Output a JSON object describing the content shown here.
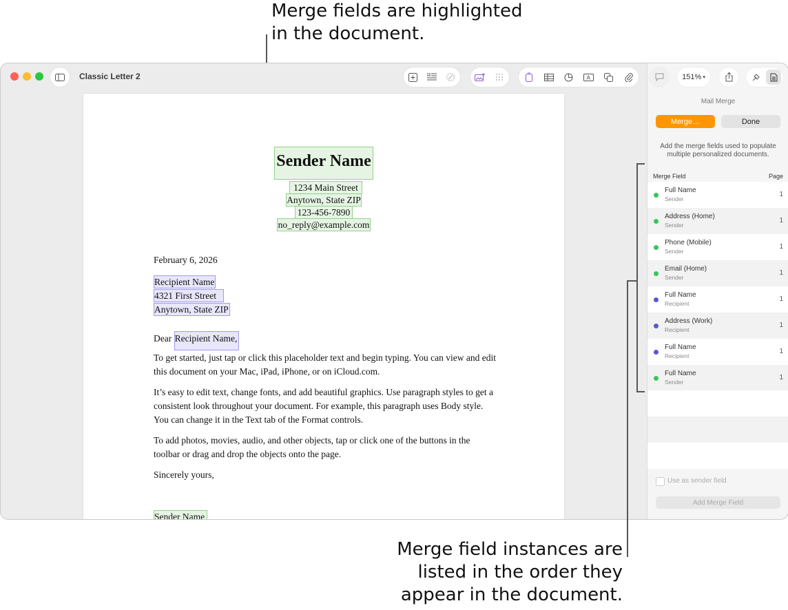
{
  "callouts": {
    "top": [
      "Merge fields are highlighted",
      "in the document."
    ],
    "bottom": [
      "Merge field instances are",
      "listed in the order they",
      "appear in the document."
    ]
  },
  "window": {
    "title": "Classic Letter 2",
    "zoom_label": "151%",
    "toolbar_icons": [
      "sidebar-icon",
      "add-page-icon",
      "list-icon",
      "magic-icon",
      "media-icon",
      "grid-icon",
      "text-box-icon",
      "table-icon",
      "chart-icon",
      "text-icon",
      "shape-icon",
      "attachment-icon",
      "comment-icon",
      "share-icon",
      "format-icon",
      "document-icon"
    ]
  },
  "document": {
    "sender_name": "Sender Name",
    "sender_address": [
      "1234 Main Street",
      "Anytown, State ZIP",
      "123-456-7890",
      "no_reply@example.com"
    ],
    "date": "February 6, 2026",
    "recipient_lines": [
      "Recipient Name",
      "4321 First Street",
      "Anytown, State ZIP"
    ],
    "salutation_prefix": "Dear ",
    "salutation_field": "Recipient Name,",
    "paragraphs": [
      "To get started, just tap or click this placeholder text and begin typing. You can view and edit this document on your Mac, iPad, iPhone, or on iCloud.com.",
      "It’s easy to edit text, change fonts, and add beautiful graphics. Use paragraph styles to get a consistent look throughout your document. For example, this paragraph uses Body style. You can change it in the Text tab of the Format controls.",
      "To add photos, movies, audio, and other objects, tap or click one of the buttons in the toolbar or drag and drop the objects onto the page."
    ],
    "closing": "Sincerely yours,",
    "signature_field": "Sender Name"
  },
  "sidebar": {
    "panel_title": "Mail Merge",
    "merge_button": "Merge…",
    "done_button": "Done",
    "description": "Add the merge fields used to populate multiple personalized documents.",
    "col_field": "Merge Field",
    "col_page": "Page",
    "fields": [
      {
        "name": "Full Name",
        "role": "Sender",
        "page": "1",
        "color": "#34c759"
      },
      {
        "name": "Address (Home)",
        "role": "Sender",
        "page": "1",
        "color": "#34c759"
      },
      {
        "name": "Phone (Mobile)",
        "role": "Sender",
        "page": "1",
        "color": "#34c759"
      },
      {
        "name": "Email (Home)",
        "role": "Sender",
        "page": "1",
        "color": "#34c759"
      },
      {
        "name": "Full Name",
        "role": "Recipient",
        "page": "1",
        "color": "#5856d6"
      },
      {
        "name": "Address (Work)",
        "role": "Recipient",
        "page": "1",
        "color": "#5856d6"
      },
      {
        "name": "Full Name",
        "role": "Recipient",
        "page": "1",
        "color": "#5856d6"
      },
      {
        "name": "Full Name",
        "role": "Sender",
        "page": "1",
        "color": "#34c759"
      }
    ],
    "checkbox_label": "Use as sender field",
    "add_field_button": "Add Merge Field"
  }
}
